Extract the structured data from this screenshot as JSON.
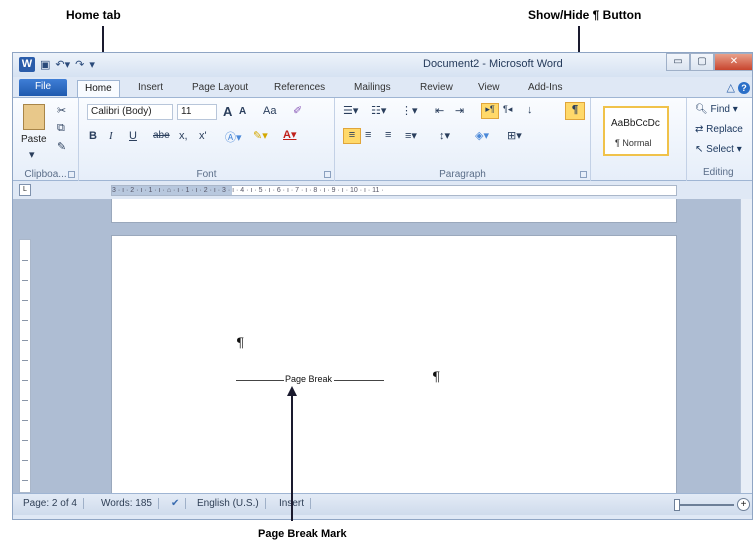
{
  "annotations": {
    "home_tab": "Home tab",
    "show_hide": "Show/Hide ¶ Button",
    "page_break_mark": "Page Break Mark"
  },
  "window": {
    "title": "Document2 - Microsoft Word",
    "app_icon": "W",
    "controls": {
      "minimize": "▭",
      "maximize": "▢",
      "close": "✕"
    }
  },
  "tabs": {
    "file": "File",
    "home": "Home",
    "insert": "Insert",
    "page_layout": "Page Layout",
    "references": "References",
    "mailings": "Mailings",
    "review": "Review",
    "view": "View",
    "addins": "Add-Ins"
  },
  "ribbon": {
    "clipboard": {
      "paste": "Paste",
      "label": "Clipboa..."
    },
    "font": {
      "name": "Calibri (Body)",
      "size": "11",
      "grow": "A",
      "shrink": "A",
      "change_case": "Aa",
      "bold": "B",
      "italic": "I",
      "underline": "U",
      "strikethrough": "abe",
      "subscript": "x,",
      "superscript": "x'",
      "label": "Font"
    },
    "paragraph": {
      "pilcrow": "¶",
      "sort": "↓",
      "label": "Paragraph"
    },
    "styles": {
      "preview": "AaBbCcDc",
      "name": "¶ Normal"
    },
    "editing": {
      "find": "Find",
      "replace": "Replace",
      "select": "Select",
      "label": "Editing"
    }
  },
  "ruler": {
    "marks": "3 · ı · 2 · ı · 1 · ı · ⌂ · ı · 1 · ı · 2 · ı · 3 · ı · 4 · ı · 5 · ı · 6 · ı · 7 · ı · 8 · ı · 9 · ı · 10 · ı · 11 ·",
    "tab_selector": "L"
  },
  "document": {
    "pilcrow_top": "¶",
    "page_break_label": "Page Break",
    "pilcrow_after_break": "¶"
  },
  "status": {
    "page": "Page: 2 of 4",
    "words": "Words: 185",
    "language": "English (U.S.)",
    "mode": "Insert",
    "zoom_plus": "+"
  },
  "colors": {
    "accent": "#2b5fa8",
    "highlight": "#ffd96a",
    "file_tab": "#2a66c0"
  }
}
